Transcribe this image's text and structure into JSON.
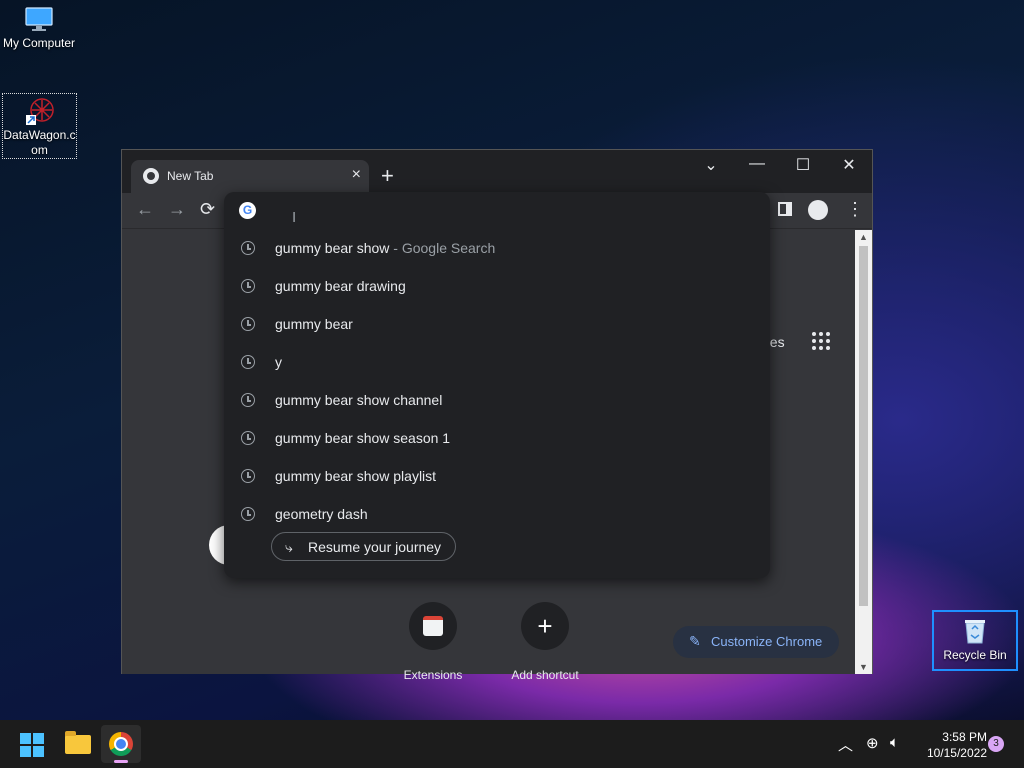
{
  "desktop": {
    "icons": [
      {
        "label": "My Computer"
      },
      {
        "label": "DataWagon.com"
      },
      {
        "label": "Recycle Bin"
      }
    ]
  },
  "browser": {
    "tab": {
      "title": "New Tab"
    },
    "window_controls": {
      "dropdown": "⌄",
      "minimize": "—",
      "maximize": "☐",
      "close": "✕"
    },
    "toolbar": {
      "back": "←",
      "forward": "→",
      "reload": "⟳"
    },
    "page": {
      "pages_fragment": "ges",
      "shortcuts": [
        {
          "label": "Extensions"
        },
        {
          "label": "Add shortcut"
        }
      ],
      "customize_label": "Customize Chrome"
    },
    "omnibox": {
      "input_value": "",
      "suggestions": [
        {
          "text": "gummy bear show",
          "hint": " - Google Search"
        },
        {
          "text": "gummy bear drawing",
          "hint": ""
        },
        {
          "text": "gummy bear",
          "hint": ""
        },
        {
          "text": "y",
          "hint": ""
        },
        {
          "text": "gummy bear show channel",
          "hint": ""
        },
        {
          "text": "gummy bear show season 1",
          "hint": ""
        },
        {
          "text": "gummy bear show playlist",
          "hint": ""
        },
        {
          "text": "geometry dash",
          "hint": ""
        }
      ],
      "resume_label": "Resume your journey"
    }
  },
  "taskbar": {
    "clock": {
      "time": "3:58 PM",
      "date": "10/15/2022"
    },
    "notification_count": "3"
  },
  "colors": {
    "accent": "#8ab4f8",
    "selection": "#1e90ff"
  }
}
